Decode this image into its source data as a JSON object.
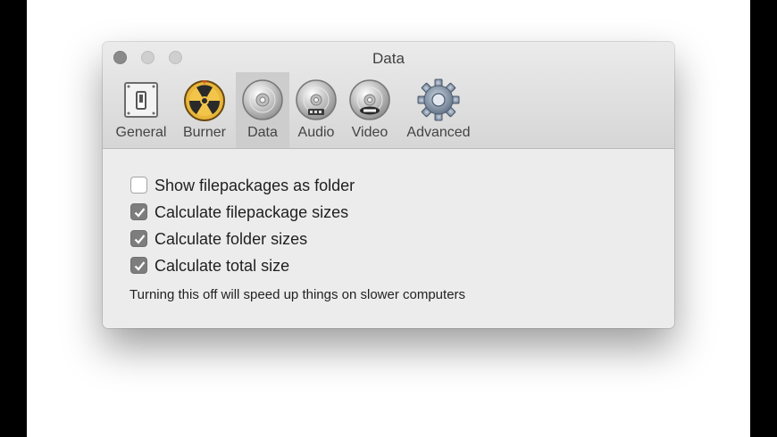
{
  "window": {
    "title": "Data"
  },
  "tabs": [
    {
      "label": "General",
      "icon": "switch-icon"
    },
    {
      "label": "Burner",
      "icon": "burner-radiation-icon"
    },
    {
      "label": "Data",
      "icon": "data-disc-icon",
      "selected": true
    },
    {
      "label": "Audio",
      "icon": "audio-disc-icon"
    },
    {
      "label": "Video",
      "icon": "dvd-disc-icon"
    },
    {
      "label": "Advanced",
      "icon": "gear-icon"
    }
  ],
  "options": [
    {
      "label": "Show filepackages as folder",
      "checked": false
    },
    {
      "label": "Calculate filepackage sizes",
      "checked": true
    },
    {
      "label": "Calculate folder sizes",
      "checked": true
    },
    {
      "label": "Calculate total size",
      "checked": true
    }
  ],
  "note": "Turning this off will speed up things on slower computers",
  "colors": {
    "checkbox_checked": "#7d7d7d",
    "selected_tab": "#cdcdcd"
  }
}
